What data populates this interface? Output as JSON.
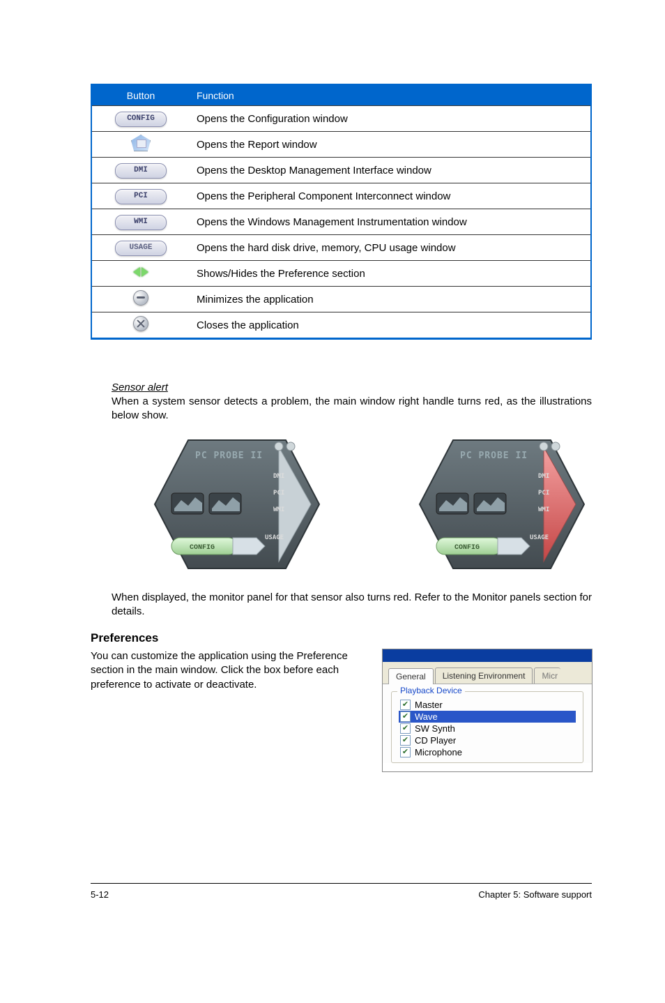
{
  "table": {
    "header": {
      "button": "Button",
      "function": "Function"
    },
    "rows": [
      {
        "btn_label": "CONFIG",
        "btn_kind": "pill",
        "func": "Opens the Configuration window"
      },
      {
        "btn_label": "",
        "btn_kind": "report",
        "func": "Opens the Report window"
      },
      {
        "btn_label": "DMI",
        "btn_kind": "pill",
        "func": "Opens the Desktop Management Interface window"
      },
      {
        "btn_label": "PCI",
        "btn_kind": "pill",
        "func": "Opens the Peripheral Component Interconnect window"
      },
      {
        "btn_label": "WMI",
        "btn_kind": "pill",
        "func": "Opens the Windows Management Instrumentation window"
      },
      {
        "btn_label": "USAGE",
        "btn_kind": "pill",
        "func": "Opens the hard disk drive, memory, CPU usage window"
      },
      {
        "btn_label": "",
        "btn_kind": "arrows",
        "func": "Shows/Hides the Preference section"
      },
      {
        "btn_label": "",
        "btn_kind": "minimize",
        "func": "Minimizes the application"
      },
      {
        "btn_label": "",
        "btn_kind": "close",
        "func": "Closes the application"
      }
    ]
  },
  "sensor": {
    "title": "Sensor alert",
    "para1": "When a system sensor detects a problem, the main window right handle turns red, as the illustrations below show.",
    "para2": "When displayed, the monitor panel for that sensor also turns red. Refer to the Monitor panels section for details."
  },
  "hex": {
    "title": "PC PROBE II",
    "sides": [
      "DMI",
      "PCI",
      "WMI",
      "USAGE"
    ],
    "config_label": "CONFIG"
  },
  "prefs": {
    "heading": "Preferences",
    "para": "You can customize the application using the Preference section in the main window. Click the box before each preference to activate or deactivate.",
    "tabs": {
      "general": "General",
      "listening": "Listening Environment",
      "mic": "Micr"
    },
    "groupbox_title": "Playback Device",
    "options": [
      {
        "label": "Master",
        "checked": true,
        "selected": false
      },
      {
        "label": "Wave",
        "checked": true,
        "selected": true
      },
      {
        "label": "SW Synth",
        "checked": true,
        "selected": false
      },
      {
        "label": "CD Player",
        "checked": true,
        "selected": false
      },
      {
        "label": "Microphone",
        "checked": true,
        "selected": false
      }
    ]
  },
  "footer": {
    "left": "5-12",
    "right": "Chapter 5: Software support"
  }
}
